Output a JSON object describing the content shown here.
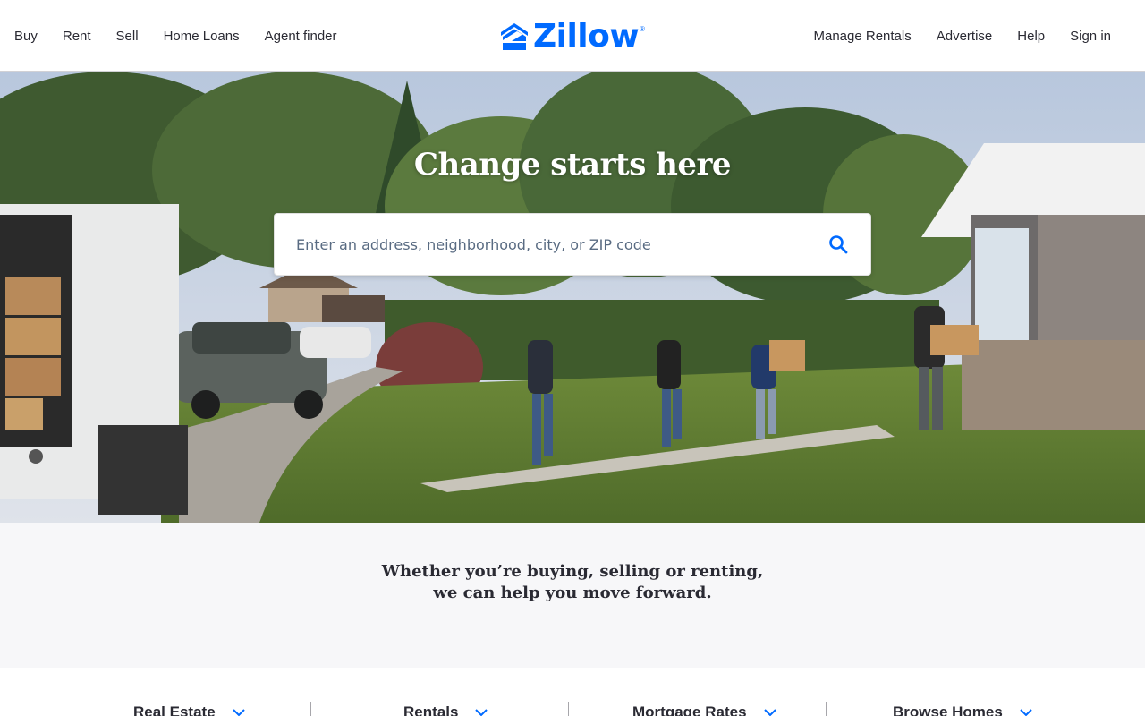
{
  "header": {
    "left_nav": [
      "Buy",
      "Rent",
      "Sell",
      "Home Loans",
      "Agent finder"
    ],
    "right_nav": [
      "Manage Rentals",
      "Advertise",
      "Help",
      "Sign in"
    ],
    "logo_text": "Zillow",
    "logo_reg": "®",
    "logo_icon": "zillow-house-icon"
  },
  "hero": {
    "title": "Change starts here",
    "search_placeholder": "Enter an address, neighborhood, city, or ZIP code",
    "search_icon": "search-icon"
  },
  "tagline": {
    "line1": "Whether you’re buying, selling or renting,",
    "line2": "we can help you move forward."
  },
  "bottom_tabs": [
    "Real Estate",
    "Rentals",
    "Mortgage Rates",
    "Browse Homes"
  ],
  "colors": {
    "brand": "#006aff",
    "text": "#2a2a33",
    "band": "#f7f7f9"
  }
}
